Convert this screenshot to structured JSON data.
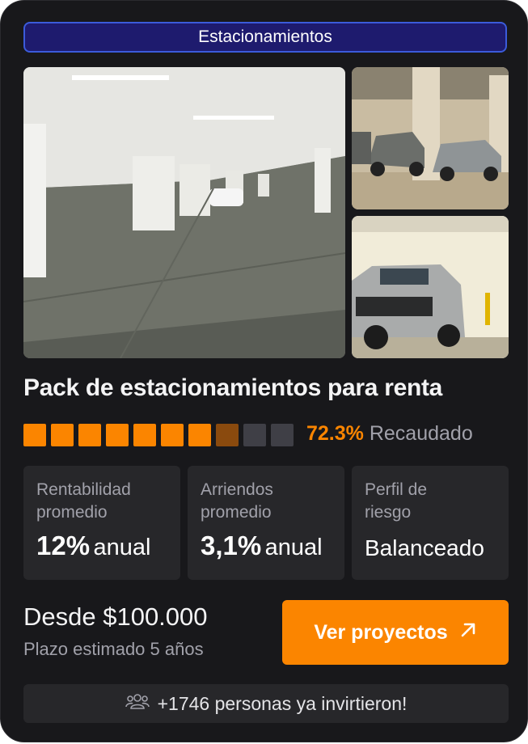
{
  "category": "Estacionamientos",
  "images": {
    "main": "underground-parking-photo",
    "top_right": "parked-cars-photo",
    "bottom_right": "suv-parking-photo"
  },
  "title": "Pack de estacionamientos para renta",
  "funding": {
    "percent_value": 72.3,
    "percent_text": "72.3%",
    "label": "Recaudado",
    "segments": 10,
    "colors": {
      "filled": "#fb8500",
      "partial": "#8a4a0e",
      "empty": "#3f3f46"
    }
  },
  "stats": [
    {
      "label": "Rentabilidad\npromedio",
      "value_big": "12%",
      "value_small": "anual"
    },
    {
      "label": "Arriendos\npromedio",
      "value_big": "3,1%",
      "value_small": "anual"
    },
    {
      "label": "Perfil de\nriesgo",
      "value_plain": "Balanceado"
    }
  ],
  "price": "Desde $100.000",
  "term": "Plazo estimado 5 años",
  "cta": {
    "label": "Ver proyectos",
    "icon": "arrow-up-right-icon"
  },
  "footer": {
    "icon": "users-icon",
    "text": "+1746 personas ya invirtieron!"
  },
  "colors": {
    "accent": "#fb8500",
    "card_bg": "#18181b",
    "tile_bg": "#27272a",
    "badge_bg": "#1e1b6e"
  }
}
